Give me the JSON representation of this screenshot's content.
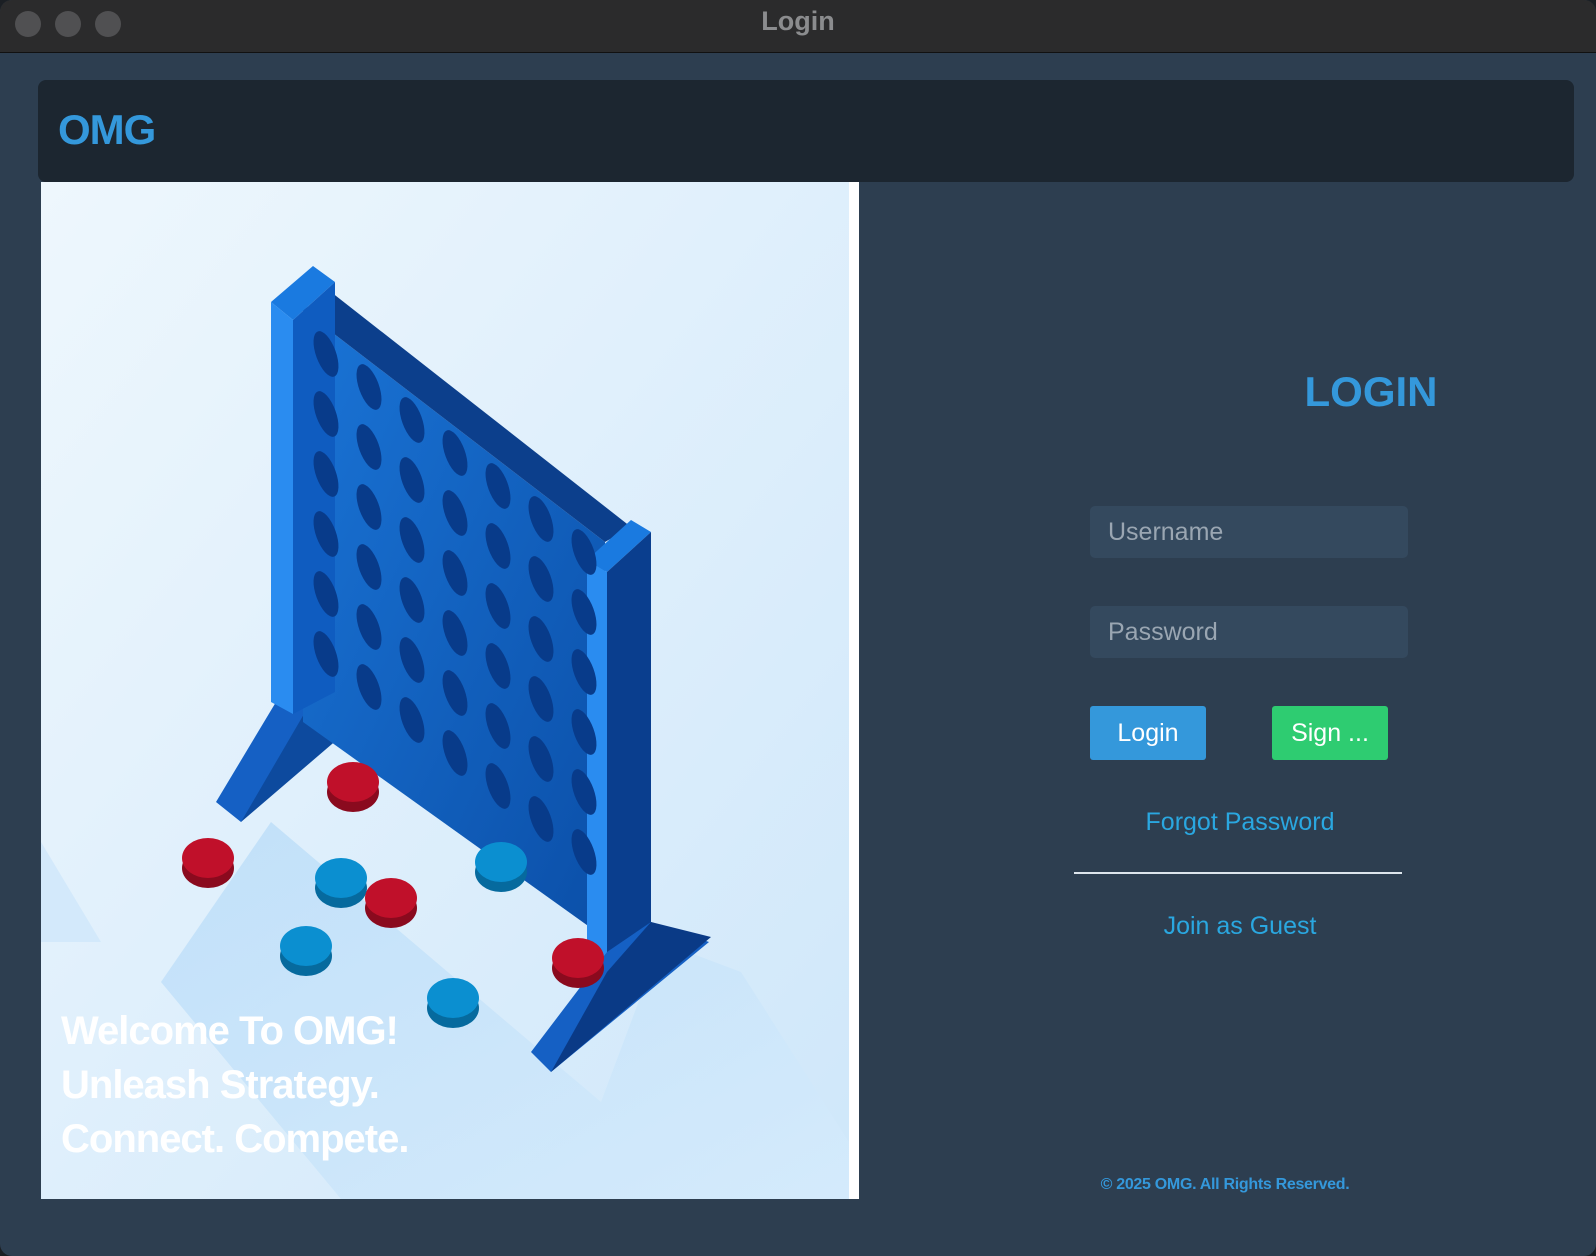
{
  "window": {
    "title": "Login"
  },
  "header": {
    "brand": "OMG"
  },
  "hero": {
    "lines": [
      "Welcome To OMG!",
      "Unleash Strategy.",
      "Connect. Compete."
    ]
  },
  "login": {
    "title": "LOGIN",
    "username_placeholder": "Username",
    "password_placeholder": "Password",
    "login_button": "Login",
    "signup_button": "Sign ...",
    "forgot_link": "Forgot Password",
    "guest_link": "Join as Guest"
  },
  "footer": {
    "copyright": "© 2025 OMG. All Rights Reserved."
  },
  "colors": {
    "accent": "#3498db",
    "signup": "#2ecc71",
    "background": "#2d3e50",
    "header_bar": "#1c2630"
  }
}
